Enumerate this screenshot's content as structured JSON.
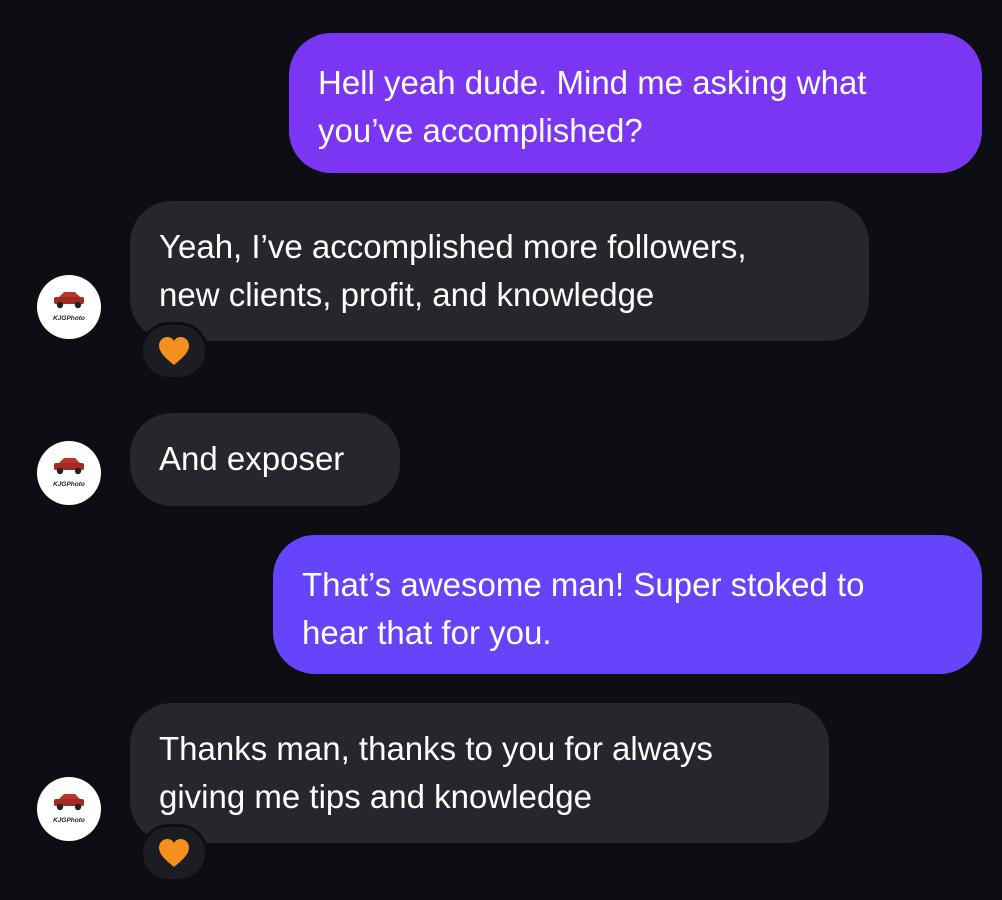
{
  "colors": {
    "background": "#0d0e13",
    "incoming_bubble": "#26272c",
    "outgoing_bubble_1": "#7a36f2",
    "outgoing_bubble_2": "#6644fb",
    "reaction": "#f5901f"
  },
  "contact": {
    "avatar_text": "KJGPhoto",
    "avatar_icon": "red-car-logo"
  },
  "messages": [
    {
      "direction": "outgoing",
      "text": "Hell yeah dude. Mind me asking what\nyou’ve accomplished?"
    },
    {
      "direction": "incoming",
      "text": "Yeah, I’ve accomplished more followers,\nnew clients, profit, and knowledge",
      "reaction": "orange-heart-icon"
    },
    {
      "direction": "incoming",
      "text": "And exposer"
    },
    {
      "direction": "outgoing",
      "text": "That’s awesome man! Super stoked to\nhear that for you."
    },
    {
      "direction": "incoming",
      "text": "Thanks man, thanks to you for always\ngiving me tips and knowledge",
      "reaction": "orange-heart-icon"
    }
  ]
}
